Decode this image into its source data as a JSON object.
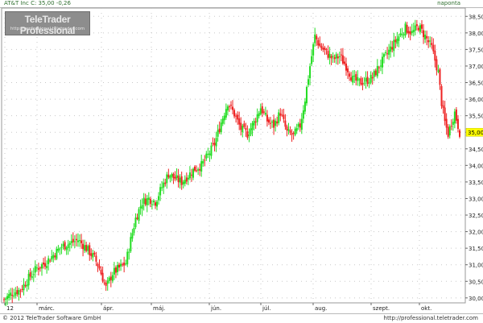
{
  "header": {
    "instrument": "AT&T Inc",
    "close_text": "C: 35,00",
    "change_text": "-0,26",
    "frequency": "napontа"
  },
  "watermark": {
    "brand": "TeleTrader Professional",
    "url": "http://professional.teletrader.com"
  },
  "footer": {
    "copyright": "© 2012 TeleTrader Software GmbH",
    "link": "http://professional.teletrader.com"
  },
  "colors": {
    "up": "#22dd22",
    "down": "#ee2222",
    "grid": "#c8c8c8",
    "last_price_bg": "#ffff00"
  },
  "chart_data": {
    "type": "candlestick",
    "x_tick_labels": [
      "12",
      "márc.",
      "ápr.",
      "máj.",
      "jún.",
      "júl.",
      "aug.",
      "szept.",
      "okt."
    ],
    "y_ticks": [
      30.0,
      30.5,
      31.0,
      31.5,
      32.0,
      32.5,
      33.0,
      33.5,
      34.0,
      34.5,
      35.0,
      35.5,
      36.0,
      36.5,
      37.0,
      37.5,
      38.0,
      38.5
    ],
    "y_tick_labels": [
      "30,00",
      "30,50",
      "31,00",
      "31,50",
      "32,00",
      "32,50",
      "33,00",
      "33,50",
      "34,00",
      "34,50",
      "35,00",
      "35,50",
      "36,00",
      "36,50",
      "37,00",
      "37,50",
      "38,00",
      "38,50"
    ],
    "ylim": [
      29.85,
      38.75
    ],
    "last_price": 35.0,
    "last_price_label": "35,00",
    "anchors": [
      [
        0,
        29.95
      ],
      [
        5,
        30.15
      ],
      [
        10,
        30.25
      ],
      [
        15,
        30.6
      ],
      [
        20,
        30.9
      ],
      [
        25,
        31.05
      ],
      [
        30,
        31.3
      ],
      [
        35,
        31.55
      ],
      [
        40,
        31.65
      ],
      [
        45,
        31.75
      ],
      [
        50,
        31.5
      ],
      [
        55,
        31.2
      ],
      [
        58,
        30.9
      ],
      [
        62,
        30.3
      ],
      [
        66,
        30.75
      ],
      [
        70,
        30.9
      ],
      [
        74,
        31.05
      ],
      [
        77,
        31.75
      ],
      [
        80,
        32.4
      ],
      [
        84,
        32.9
      ],
      [
        88,
        33.0
      ],
      [
        92,
        32.9
      ],
      [
        96,
        33.35
      ],
      [
        100,
        33.75
      ],
      [
        104,
        33.6
      ],
      [
        108,
        33.5
      ],
      [
        112,
        33.7
      ],
      [
        116,
        33.9
      ],
      [
        120,
        34.0
      ],
      [
        124,
        34.3
      ],
      [
        128,
        34.65
      ],
      [
        132,
        35.3
      ],
      [
        136,
        35.9
      ],
      [
        140,
        35.55
      ],
      [
        144,
        35.1
      ],
      [
        148,
        34.95
      ],
      [
        152,
        35.3
      ],
      [
        156,
        35.75
      ],
      [
        160,
        35.35
      ],
      [
        164,
        35.2
      ],
      [
        168,
        35.6
      ],
      [
        172,
        35.0
      ],
      [
        176,
        34.9
      ],
      [
        180,
        35.2
      ],
      [
        183,
        36.0
      ],
      [
        186,
        37.0
      ],
      [
        189,
        37.9
      ],
      [
        192,
        37.6
      ],
      [
        196,
        37.4
      ],
      [
        200,
        37.2
      ],
      [
        204,
        37.3
      ],
      [
        208,
        37.0
      ],
      [
        212,
        36.6
      ],
      [
        216,
        36.5
      ],
      [
        220,
        36.55
      ],
      [
        224,
        36.65
      ],
      [
        228,
        37.0
      ],
      [
        232,
        37.3
      ],
      [
        236,
        37.6
      ],
      [
        240,
        37.9
      ],
      [
        244,
        38.15
      ],
      [
        248,
        38.0
      ],
      [
        252,
        38.2
      ],
      [
        256,
        37.9
      ],
      [
        260,
        37.55
      ],
      [
        264,
        36.8
      ],
      [
        266,
        35.9
      ],
      [
        268,
        35.3
      ],
      [
        270,
        34.95
      ],
      [
        272,
        35.3
      ],
      [
        274,
        35.6
      ],
      [
        277,
        35.0
      ]
    ]
  }
}
